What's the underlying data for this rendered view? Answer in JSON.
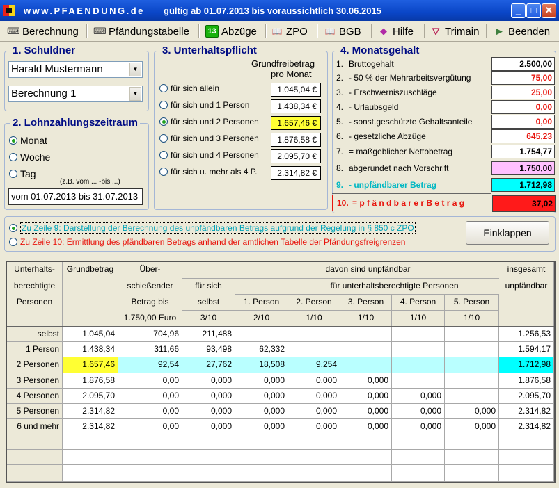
{
  "titlebar": {
    "site": "www.PFAENDUNG.de",
    "validity": "gültig ab 01.07.2013 bis voraussichtlich 30.06.2015",
    "minimize": "_",
    "maximize": "□",
    "close": "✕"
  },
  "toolbar": [
    {
      "label": "Berechnung",
      "icon": "calculator-icon",
      "glyph": "⌨"
    },
    {
      "label": "Pfändungstabelle",
      "icon": "table-icon",
      "glyph": "⌨"
    },
    {
      "label": "Abzüge",
      "icon": "badge-13-icon",
      "glyph": "13"
    },
    {
      "label": "ZPO",
      "icon": "book-icon",
      "glyph": "📖"
    },
    {
      "label": "BGB",
      "icon": "book-icon",
      "glyph": "📖"
    },
    {
      "label": "Hilfe",
      "icon": "help-book-icon",
      "glyph": "◆"
    },
    {
      "label": "Trimain",
      "icon": "trimain-icon",
      "glyph": "▽"
    },
    {
      "label": "Beenden",
      "icon": "exit-icon",
      "glyph": "▶"
    }
  ],
  "schuldner": {
    "title": "1. Schuldner",
    "name": "Harald Mustermann",
    "calculation": "Berechnung 1"
  },
  "lohnzahlung": {
    "title": "2. Lohnzahlungszeitraum",
    "options": [
      "Monat",
      "Woche",
      "Tag"
    ],
    "selected": 0,
    "hint": "(z.B. vom ... -bis ...)",
    "period": "vom 01.07.2013 bis 31.07.2013"
  },
  "unterhalt": {
    "title": "3. Unterhaltspflicht",
    "header_line1": "Grundfreibetrag",
    "header_line2": "pro Monat",
    "selected": 2,
    "options": [
      {
        "label": "für sich allein",
        "amount": "1.045,04 €"
      },
      {
        "label": "für sich und 1 Person",
        "amount": "1.438,34 €"
      },
      {
        "label": "für sich und 2 Personen",
        "amount": "1.657,46 €"
      },
      {
        "label": "für sich und 3 Personen",
        "amount": "1.876,58 €"
      },
      {
        "label": "für sich und 4 Personen",
        "amount": "2.095,70 €"
      },
      {
        "label": "für sich u. mehr als 4 P.",
        "amount": "2.314,82 €"
      }
    ]
  },
  "monatsgehalt": {
    "title": "4. Monatsgehalt",
    "rows": [
      {
        "no": "1.",
        "label": "Bruttogehalt",
        "value": "2.500,00"
      },
      {
        "no": "2.",
        "label": "-  50 % der Mehrarbeitsvergütung",
        "value": "75,00"
      },
      {
        "no": "3.",
        "label": "-  Erschwerniszuschläge",
        "value": "25,00"
      },
      {
        "no": "4.",
        "label": "-  Urlaubsgeld",
        "value": "0,00"
      },
      {
        "no": "5.",
        "label": "-  sonst.geschützte Gehaltsanteile",
        "value": "0,00"
      },
      {
        "no": "6.",
        "label": "-  gesetzliche Abzüge",
        "value": "645,23"
      },
      {
        "no": "7.",
        "label": "=  maßgeblicher Nettobetrag",
        "value": "1.754,77"
      },
      {
        "no": "8.",
        "label": "abgerundet nach Vorschrift",
        "value": "1.750,00"
      },
      {
        "no": "9.",
        "label": "-  unpfändbarer Betrag",
        "value": "1.712,98"
      },
      {
        "no": "10.",
        "label": "=  p f ä n d b a r e r   B e t r a g",
        "value": "37,02"
      }
    ],
    "colors": {
      "red": "#e8150d",
      "pink": "#ffc0ff",
      "cyan": "#00ffff",
      "cyan_text": "#00b7c3",
      "result_bg": "#ff1a1a"
    }
  },
  "explain": {
    "option1": "Zu Zeile 9:   Darstellung der Berechnung des unpfändbaren Betrags aufgrund der Regelung in § 850 c ZPO",
    "option2": "Zu Zeile 10: Ermittlung des pfändbaren Betrags anhand der amtlichen Tabelle der Pfändungsfreigrenzen",
    "selected": 0,
    "collapse_button": "Einklappen"
  },
  "grid": {
    "headers": {
      "c0": [
        "Unterhalts-",
        "berechtigte",
        "Personen"
      ],
      "c1": "Grundbetrag",
      "c2": [
        "Über-",
        "schießender",
        "Betrag bis",
        "1.750,00 Euro"
      ],
      "davon": "davon sind unpfändbar",
      "selbst": [
        "für sich",
        "selbst",
        "3/10"
      ],
      "fuer": "für unterhaltsberechtigte Personen",
      "persons": [
        "1. Person",
        "2. Person",
        "3. Person",
        "4. Person",
        "5. Person"
      ],
      "person_frac": [
        "2/10",
        "1/10",
        "1/10",
        "1/10",
        "1/10"
      ],
      "total": [
        "insgesamt",
        "unpfändbar"
      ]
    },
    "rows": [
      {
        "label": "selbst",
        "grund": "1.045,04",
        "ueber": "704,96",
        "self": "211,488",
        "p": [
          "",
          "",
          "",
          "",
          ""
        ],
        "total": "1.256,53"
      },
      {
        "label": "1 Person",
        "grund": "1.438,34",
        "ueber": "311,66",
        "self": "93,498",
        "p": [
          "62,332",
          "",
          "",
          "",
          ""
        ],
        "total": "1.594,17"
      },
      {
        "label": "2 Personen",
        "grund": "1.657,46",
        "ueber": "92,54",
        "self": "27,762",
        "p": [
          "18,508",
          "9,254",
          "",
          "",
          ""
        ],
        "total": "1.712,98"
      },
      {
        "label": "3 Personen",
        "grund": "1.876,58",
        "ueber": "0,00",
        "self": "0,000",
        "p": [
          "0,000",
          "0,000",
          "0,000",
          "",
          ""
        ],
        "total": "1.876,58"
      },
      {
        "label": "4 Personen",
        "grund": "2.095,70",
        "ueber": "0,00",
        "self": "0,000",
        "p": [
          "0,000",
          "0,000",
          "0,000",
          "0,000",
          ""
        ],
        "total": "2.095,70"
      },
      {
        "label": "5 Personen",
        "grund": "2.314,82",
        "ueber": "0,00",
        "self": "0,000",
        "p": [
          "0,000",
          "0,000",
          "0,000",
          "0,000",
          "0,000"
        ],
        "total": "2.314,82"
      },
      {
        "label": "6 und mehr",
        "grund": "2.314,82",
        "ueber": "0,00",
        "self": "0,000",
        "p": [
          "0,000",
          "0,000",
          "0,000",
          "0,000",
          "0,000"
        ],
        "total": "2.314,82"
      }
    ],
    "highlight_row": 2,
    "colors": {
      "row_highlight": "#b9ffff",
      "grund_highlight": "#ffff33",
      "total_highlight": "#00ffff"
    }
  }
}
